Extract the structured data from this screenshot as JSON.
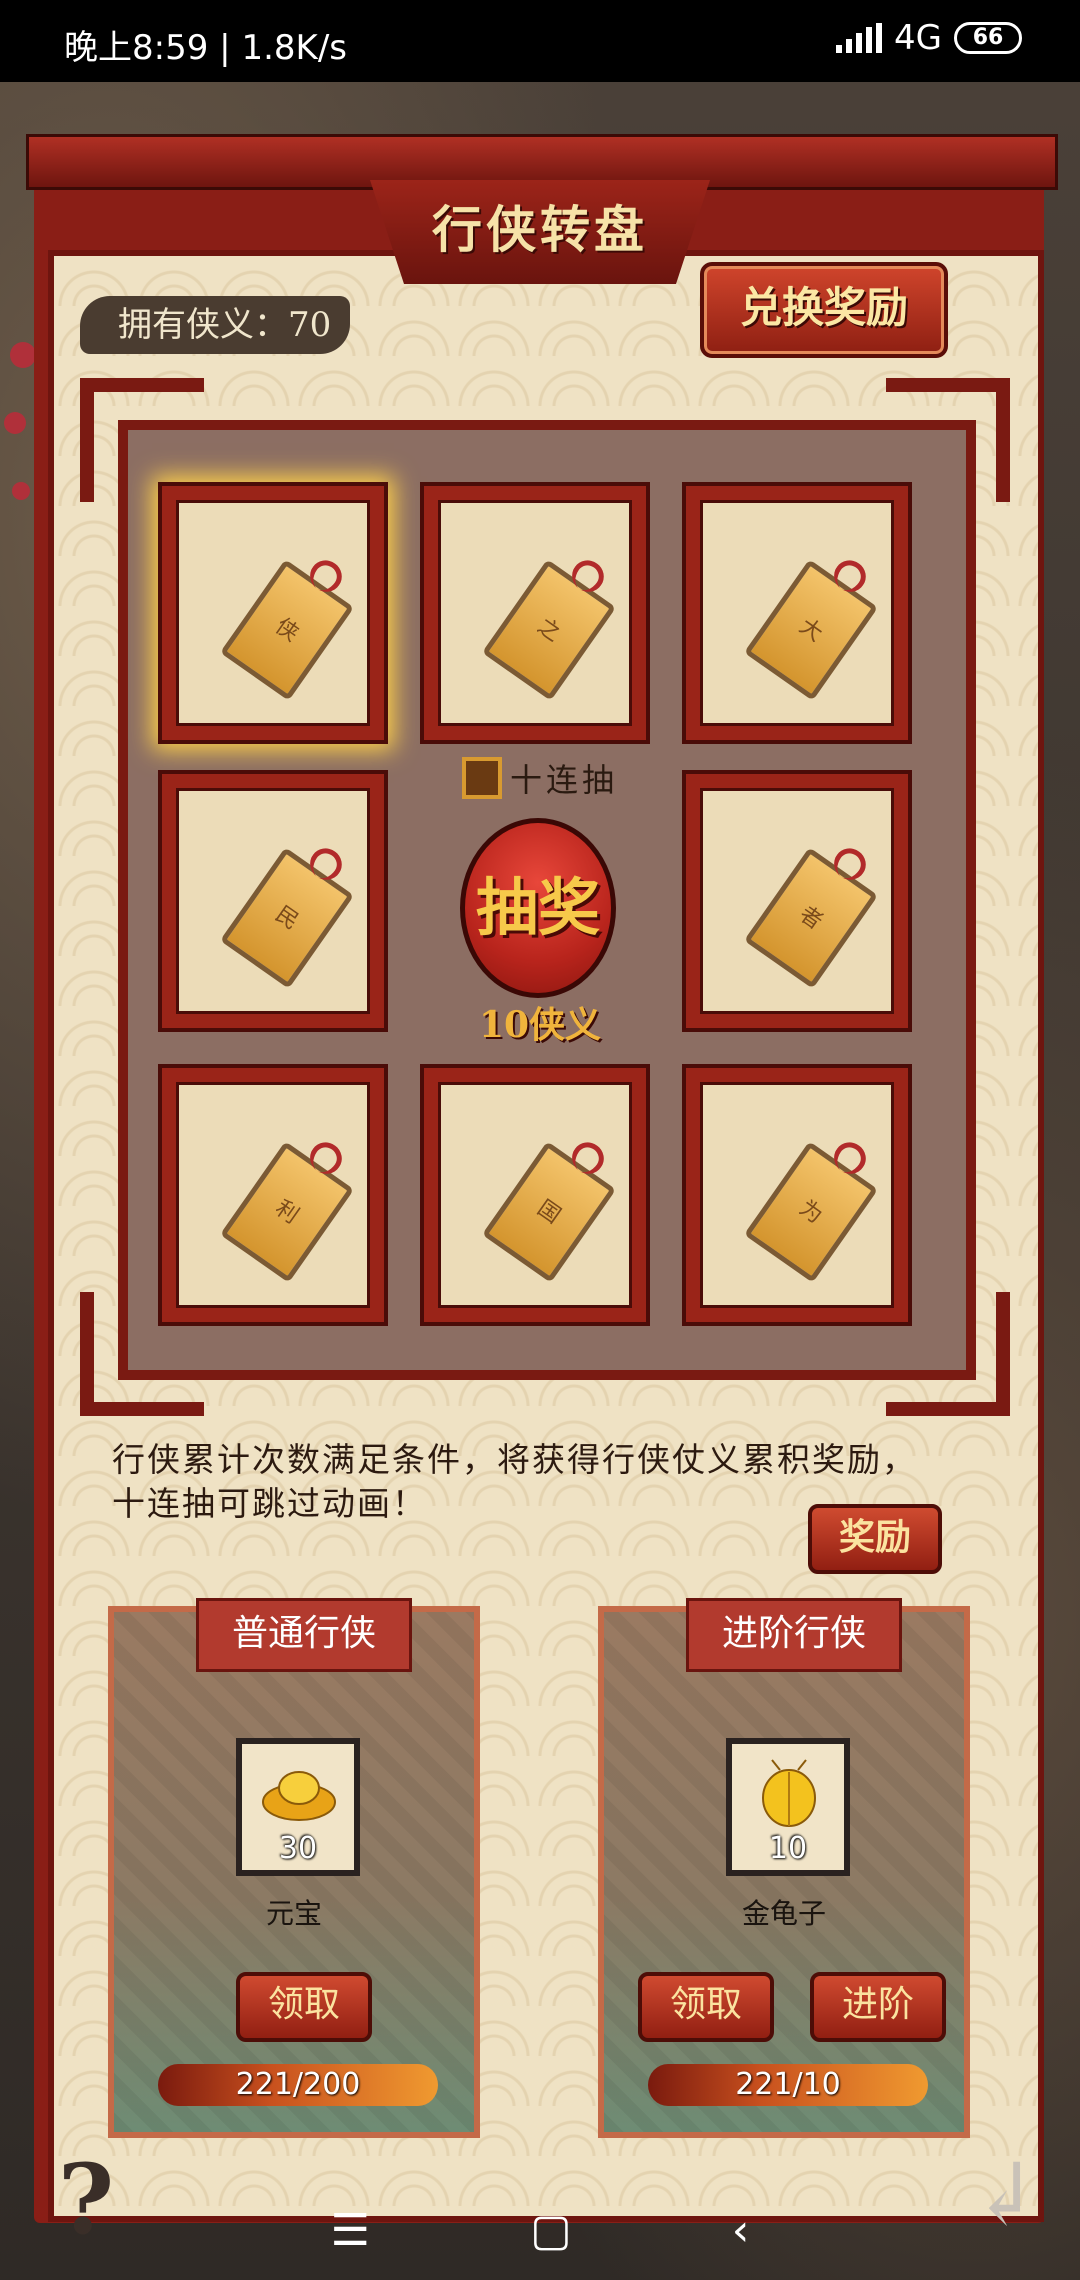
{
  "status_bar": {
    "time": "晚上8:59",
    "separator": "|",
    "speed": "1.8K/s",
    "network": "4G",
    "battery": "66"
  },
  "header": {
    "title": "行侠转盘",
    "owned_label": "拥有侠义：70",
    "exchange_button": "兑换奖励"
  },
  "board": {
    "tiles": [
      {
        "char": "侠",
        "selected": true
      },
      {
        "char": "之",
        "selected": false
      },
      {
        "char": "大",
        "selected": false
      },
      {
        "char": "民",
        "selected": false
      },
      {
        "char": "者",
        "selected": false
      },
      {
        "char": "利",
        "selected": false
      },
      {
        "char": "国",
        "selected": false
      },
      {
        "char": "为",
        "selected": false
      }
    ],
    "ten_draw_label": "十连抽",
    "draw_button": "抽奖",
    "draw_cost": "10侠义"
  },
  "rules": {
    "line1": "行侠累计次数满足条件，将获得行侠仗义累积奖励，",
    "line2": "十连抽可跳过动画！",
    "reward_button": "奖励"
  },
  "cards": {
    "normal": {
      "title": "普通行侠",
      "item_name": "元宝",
      "item_count": "30",
      "claim_button": "领取",
      "progress": "221/200"
    },
    "advanced": {
      "title": "进阶行侠",
      "item_name": "金龟子",
      "item_count": "10",
      "claim_button": "领取",
      "advance_button": "进阶",
      "progress": "221/10"
    }
  },
  "bottom": {
    "help_icon": "?",
    "back_icon": "↲",
    "nav_menu": "☰",
    "nav_home": "▢",
    "nav_back": "‹"
  }
}
